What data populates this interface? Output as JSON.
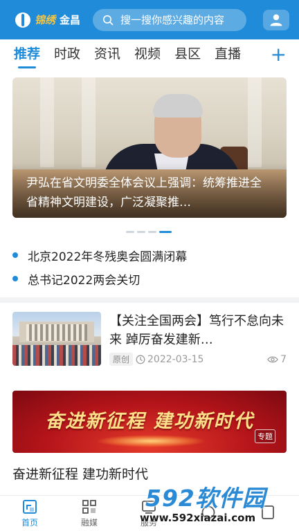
{
  "header": {
    "logo_script": "锦绣",
    "logo_name": "金昌",
    "search_placeholder": "搜一搜你感兴趣的内容"
  },
  "tabs": [
    {
      "label": "推荐",
      "active": true
    },
    {
      "label": "时政",
      "active": false
    },
    {
      "label": "资讯",
      "active": false
    },
    {
      "label": "视频",
      "active": false
    },
    {
      "label": "县区",
      "active": false
    },
    {
      "label": "直播",
      "active": false
    }
  ],
  "tab_add_label": "+",
  "carousel": {
    "slide_title": "尹弘在省文明委全体会议上强调：统筹推进全省精神文明建设，广泛凝聚推…",
    "slide_count": 4,
    "active_index": 3
  },
  "headlines": [
    "北京2022年冬残奥会圆满闭幕",
    "总书记2022两会关切"
  ],
  "news_item": {
    "title": "【关注全国两会】笃行不怠向未来 踔厉奋发建新…",
    "tag": "原创",
    "date": "2022-03-15",
    "views": "7"
  },
  "banner": {
    "text": "奋进新征程  建功新时代",
    "badge": "专题"
  },
  "section_title": "奋进新征程 建功新时代",
  "bottom_nav": [
    {
      "label": "首页",
      "icon": "home-icon",
      "active": true
    },
    {
      "label": "融媒",
      "icon": "grid-icon",
      "active": false
    },
    {
      "label": "服务",
      "icon": "service-icon",
      "active": false
    },
    {
      "label": "",
      "icon": "discover-icon",
      "active": false
    },
    {
      "label": "",
      "icon": "profile-icon",
      "active": false
    }
  ],
  "watermark": {
    "top": "592软件园",
    "bottom": "www.592xiazai.com"
  },
  "colors": {
    "brand": "#1f8bd9",
    "banner_red": "#b3141a",
    "banner_gold": "#ffe08a"
  }
}
